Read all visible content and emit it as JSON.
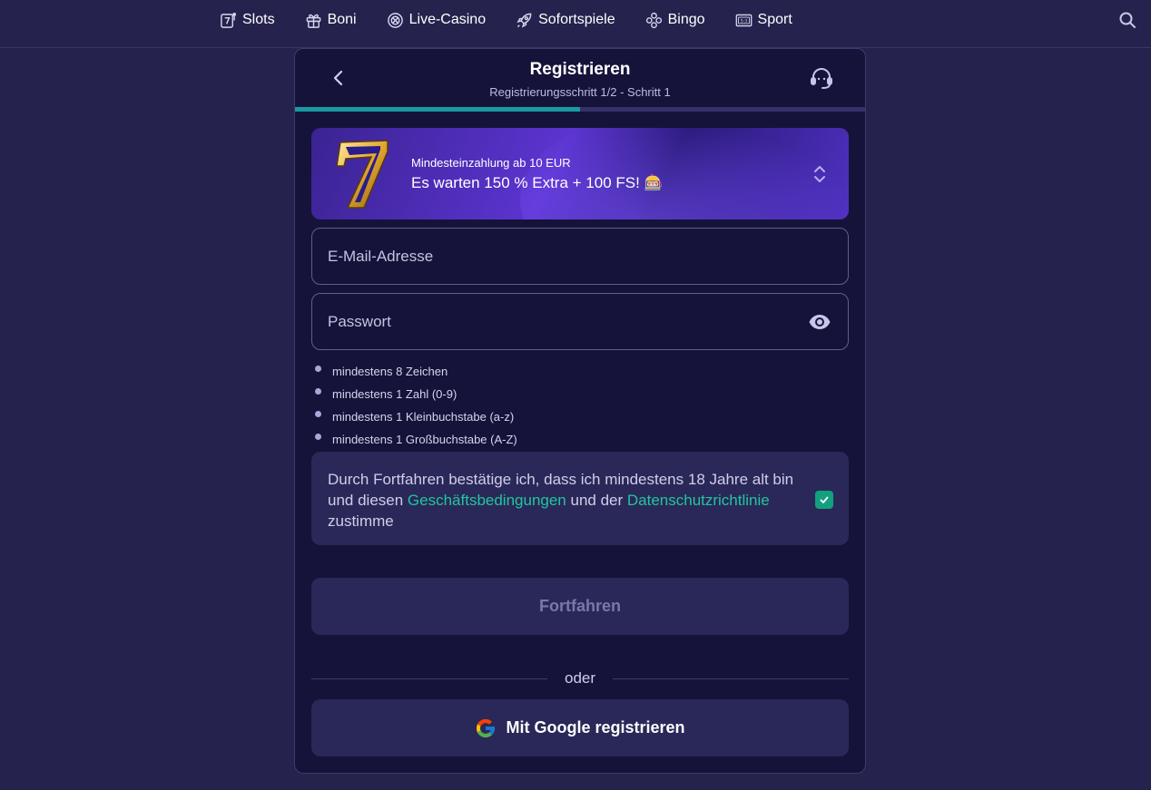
{
  "nav": {
    "items": [
      {
        "label": "Slots",
        "icon": "slot-seven-icon"
      },
      {
        "label": "Boni",
        "icon": "gift-icon"
      },
      {
        "label": "Live-Casino",
        "icon": "roulette-chip-icon"
      },
      {
        "label": "Sofortspiele",
        "icon": "rocket-icon"
      },
      {
        "label": "Bingo",
        "icon": "bingo-balls-icon"
      },
      {
        "label": "Sport",
        "icon": "scoreboard-icon"
      }
    ],
    "sport_icon_text": "5:3"
  },
  "modal": {
    "title": "Registrieren",
    "subtitle": "Registrierungsschritt 1/2 - Schritt 1",
    "progress_percent": 50
  },
  "bonus": {
    "small_text": "Mindesteinzahlung ab 10 EUR",
    "big_text": "Es warten 150 % Extra + 100 FS! 🎰"
  },
  "form": {
    "email_placeholder": "E-Mail-Adresse",
    "password_placeholder": "Passwort",
    "requirements": [
      "mindestens 8 Zeichen",
      "mindestens 1 Zahl (0-9)",
      "mindestens 1 Kleinbuchstabe (a-z)",
      "mindestens 1 Großbuchstabe (A-Z)"
    ]
  },
  "terms": {
    "part1": "Durch Fortfahren bestätige ich, dass ich mindestens 18 Jahre alt bin und diesen ",
    "link1": "Geschäftsbedingungen",
    "part2": " und der ",
    "link2": "Datenschutzrichtlinie",
    "part3": " zustimme",
    "checked": true
  },
  "buttons": {
    "continue_label": "Fortfahren",
    "or_label": "oder",
    "google_label": "Mit Google registrieren"
  },
  "colors": {
    "background": "#25234d",
    "modal": "#15133a",
    "accent_teal": "#1a9aa0",
    "link_green": "#22c59d"
  }
}
